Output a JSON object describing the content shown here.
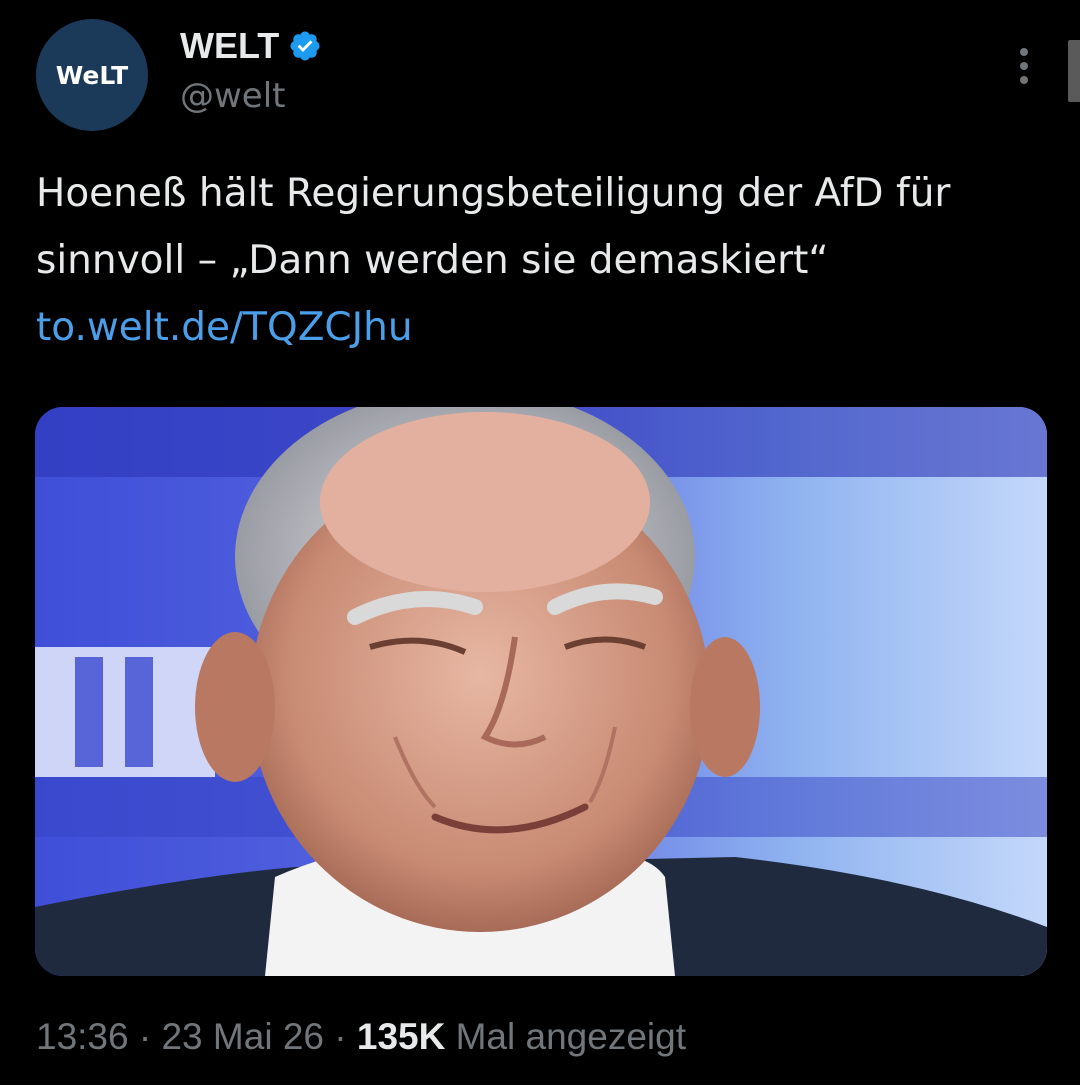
{
  "author": {
    "avatar_text": "WeLT",
    "display_name": "WELT",
    "verified": true,
    "handle": "@welt"
  },
  "tweet": {
    "text": "Hoeneß hält Regierungsbeteiligung der AfD für sinnvoll – „Dann werden sie demaskiert“",
    "link": "to.welt.de/TQZCJhu"
  },
  "meta": {
    "time": "13:36",
    "separator1": " · ",
    "date": "23 Mai 26",
    "separator2": " · ",
    "views_count": "135K",
    "views_label": " Mal angezeigt"
  },
  "colors": {
    "background": "#000000",
    "text": "#e7e9ea",
    "secondary_text": "#71767b",
    "link": "#4a9fe8",
    "verified_badge": "#1d9bf0",
    "avatar_bg": "#1b3a59"
  },
  "icons": {
    "verified": "verified-badge-icon",
    "more": "more-vertical-icon"
  }
}
